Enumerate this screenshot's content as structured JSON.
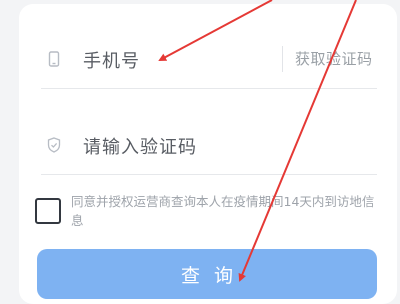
{
  "form": {
    "phone_label": "手机号",
    "get_code_label": "获取验证码",
    "code_label": "请输入验证码",
    "consent_text": "同意并授权运营商查询本人在疫情期间14天内到访地信息",
    "consent_checked": false,
    "submit_label": "查询"
  },
  "colors": {
    "button_bg": "#7eb2f2",
    "annotation": "#e53935"
  },
  "icons": {
    "phone": "phone-icon",
    "shield": "shield-check-icon"
  }
}
